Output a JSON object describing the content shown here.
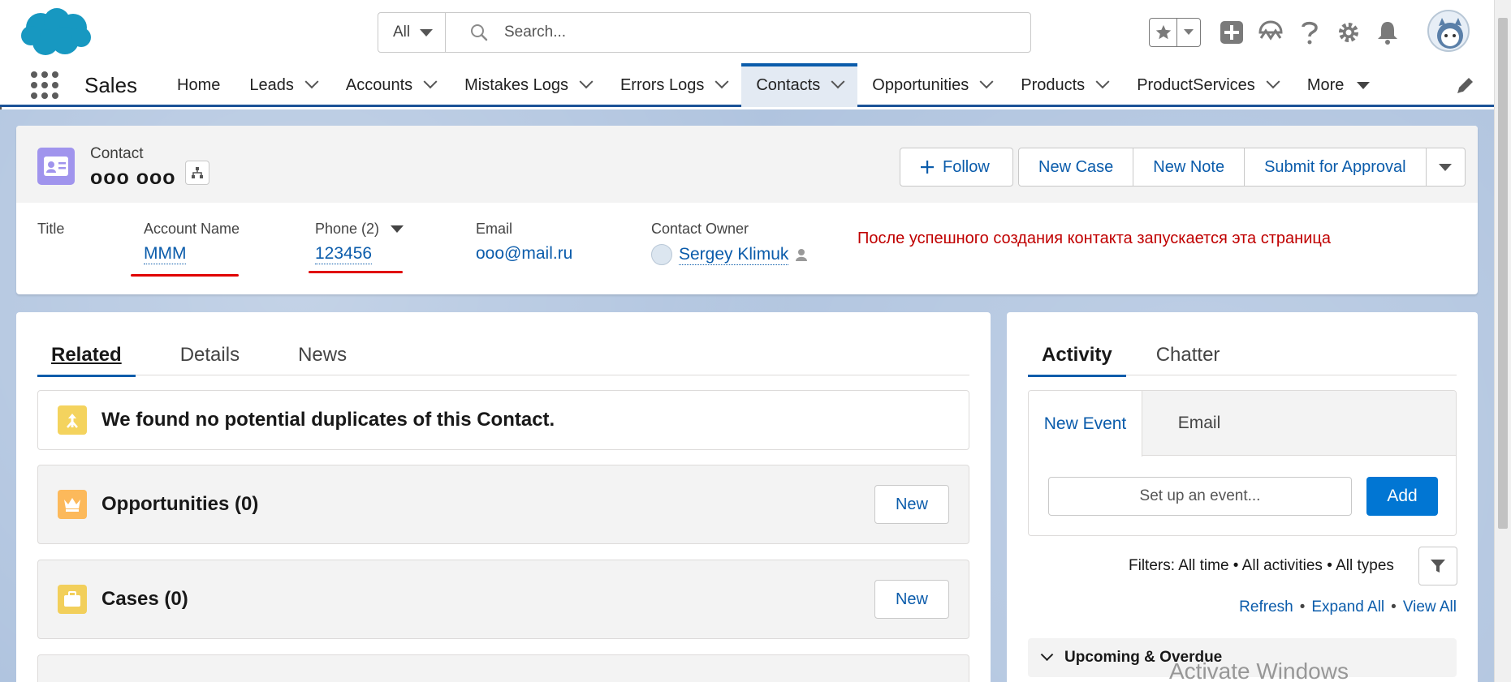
{
  "header": {
    "search_scope": "All",
    "search_placeholder": "Search..."
  },
  "nav": {
    "app_name": "Sales",
    "tabs": [
      {
        "label": "Home"
      },
      {
        "label": "Leads"
      },
      {
        "label": "Accounts"
      },
      {
        "label": "Mistakes Logs"
      },
      {
        "label": "Errors Logs"
      },
      {
        "label": "Contacts"
      },
      {
        "label": "Opportunities"
      },
      {
        "label": "Products"
      },
      {
        "label": "ProductServices"
      },
      {
        "label": "More"
      }
    ]
  },
  "record": {
    "object_label": "Contact",
    "name": "ooo ooo",
    "actions": {
      "follow": "Follow",
      "new_case": "New Case",
      "new_note": "New Note",
      "submit": "Submit for Approval"
    },
    "fields": {
      "title_label": "Title",
      "account_label": "Account Name",
      "account_value": "MMM",
      "phone_label": "Phone (2)",
      "phone_value": "123456",
      "email_label": "Email",
      "email_value": "ooo@mail.ru",
      "owner_label": "Contact Owner",
      "owner_value": "Sergey Klimuk"
    },
    "note": "После успешного создания контакта запускается эта страница"
  },
  "related": {
    "tabs": [
      "Related",
      "Details",
      "News"
    ],
    "duplicates_message": "We found no potential duplicates of this Contact.",
    "lists": [
      {
        "title": "Opportunities (0)",
        "button": "New",
        "color": "#fcb95b"
      },
      {
        "title": "Cases (0)",
        "button": "New",
        "color": "#f2cf5b"
      }
    ],
    "duplicate_icon_color": "#f4d35e"
  },
  "activity": {
    "tabs": [
      "Activity",
      "Chatter"
    ],
    "publisher_tabs": [
      "New Event",
      "Email"
    ],
    "event_placeholder": "Set up an event...",
    "add_label": "Add",
    "filters": "Filters: All time • All activities • All types",
    "links": {
      "refresh": "Refresh",
      "expand": "Expand All",
      "view": "View All"
    },
    "upcoming": "Upcoming & Overdue"
  },
  "watermark": "Activate Windows",
  "colors": {
    "brand_blue": "#0b5cab",
    "contact_icon": "#a094ed",
    "annotation_red": "#e00000"
  }
}
